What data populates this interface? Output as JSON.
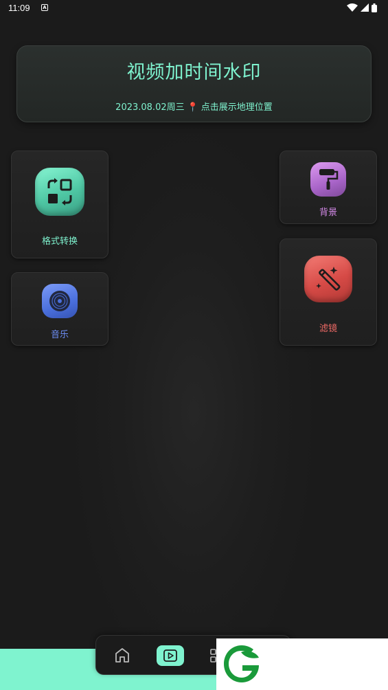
{
  "status_bar": {
    "time": "11:09",
    "notification_icon": "a-icon"
  },
  "header": {
    "title": "视频加时间水印",
    "date": "2023.08.02周三",
    "location_icon": "pin-icon",
    "location_text": "点击展示地理位置"
  },
  "tools": {
    "format": {
      "label": "格式转换",
      "color": "#7ff3cf"
    },
    "music": {
      "label": "音乐",
      "color": "#6d8ef5"
    },
    "background": {
      "label": "背景",
      "color": "#d48ae8"
    },
    "filter": {
      "label": "滤镜",
      "color": "#f06a66"
    }
  },
  "bottom_nav": {
    "items": [
      {
        "icon": "home-icon"
      },
      {
        "icon": "video-icon",
        "active": true
      },
      {
        "icon": "grid-icon"
      }
    ],
    "accent": "#7ff3cf"
  }
}
